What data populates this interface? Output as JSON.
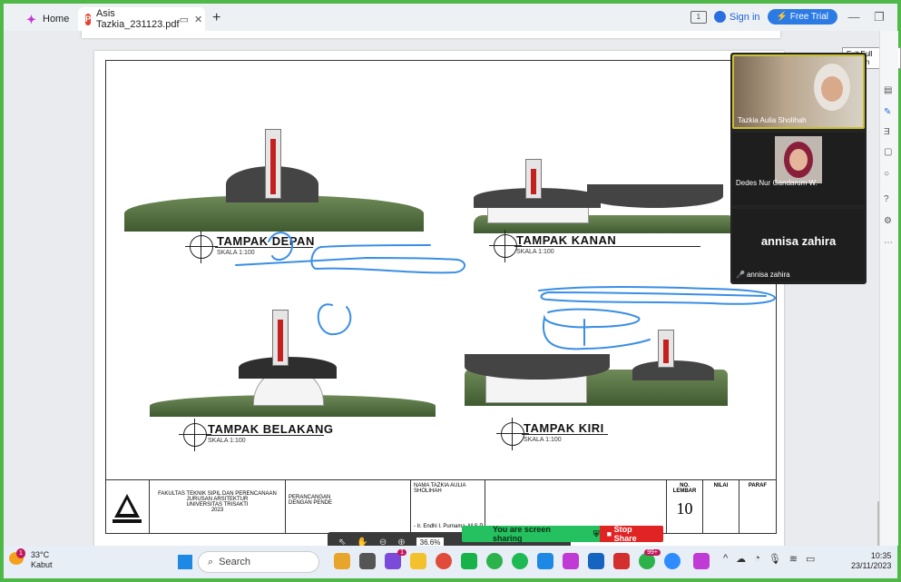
{
  "tabs": [
    {
      "label": "Home"
    },
    {
      "label": "Asis Tazkia_231123.pdf"
    }
  ],
  "header": {
    "sign_in": "Sign in",
    "free_trial": "Free Trial"
  },
  "exit_full_screen": "Exit Full Screen",
  "drawings": {
    "front": {
      "title": "TAMPAK DEPAN",
      "scale": "SKALA 1:100"
    },
    "right": {
      "title": "TAMPAK KANAN",
      "scale": "SKALA 1:100"
    },
    "back": {
      "title": "TAMPAK BELAKANG",
      "scale": "SKALA 1:100"
    },
    "left": {
      "title": "TAMPAK KIRI",
      "scale": "SKALA 1:100"
    }
  },
  "title_block": {
    "faculty": "FAKULTAS TEKNIK SIPIL DAN PERENCANAAN",
    "department": "JURUSAN ARSITEKTUR",
    "university": "UNIVERSITAS TRISAKTI",
    "year": "2023",
    "project_line1": "PERANCANGAN",
    "project_line2": "DENGAN PENDE",
    "name_label": "NAMA",
    "name_value": "TAZKIA AULIA SHOLIHAH",
    "advisor": "- Ir. Endhi I. Purnama, M.S.P.",
    "sheet_no_label": "NO. LEMBAR",
    "grade_label": "NILAI",
    "initial_label": "PARAF",
    "sheet_no": "10"
  },
  "participants": [
    {
      "name": "Tazkia Aulia Sholihah"
    },
    {
      "name": "Dedes Nur Gandarum W."
    },
    {
      "name": "annisa zahira",
      "display": "annisa zahira"
    }
  ],
  "pdf_toolbar": {
    "zoom": "36.6%"
  },
  "share_bar": {
    "status": "You are screen sharing",
    "stop": "Stop Share"
  },
  "taskbar": {
    "temperature": "33°C",
    "weather": "Kabut",
    "weather_badge": "1",
    "search": "Search",
    "time": "10:35",
    "date": "23/11/2023",
    "badge_counts": [
      "1",
      "99+"
    ]
  }
}
